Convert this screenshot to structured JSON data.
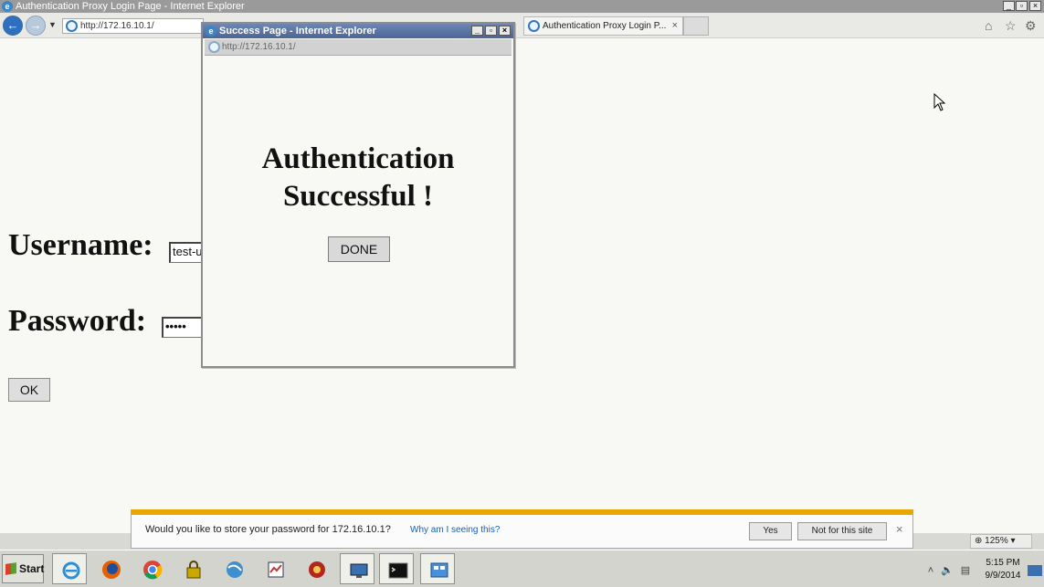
{
  "window": {
    "title": "Authentication Proxy Login Page - Internet Explorer"
  },
  "browser": {
    "address": "http://172.16.10.1/",
    "tab_title": "Authentication Proxy Login P...",
    "tab_close": "×"
  },
  "login": {
    "username_label": "Username:",
    "username_value": "test-u",
    "password_label": "Password:",
    "password_value": "•••••",
    "ok_label": "OK"
  },
  "popup": {
    "title": "Success Page - Internet Explorer",
    "address": "http://172.16.10.1/",
    "message_line1": "Authentication",
    "message_line2": "Successful !",
    "done_label": "DONE"
  },
  "notification": {
    "message": "Would you like to store your password for 172.16.10.1?",
    "link": "Why am I seeing this?",
    "yes_label": "Yes",
    "no_label": "Not for this site",
    "close": "×"
  },
  "statusbar": {
    "zoom": "125%"
  },
  "taskbar": {
    "start_label": "Start",
    "time": "5:15 PM",
    "date": "9/9/2014",
    "apps": [
      "internet-explorer",
      "firefox",
      "chrome",
      "keychain",
      "network",
      "task-manager",
      "avast",
      "remote-desktop",
      "command-prompt",
      "control-panel"
    ]
  },
  "colors": {
    "notification_accent": "#e8a800",
    "popup_title_bar": "#4b6596",
    "link": "#1a5fb4"
  }
}
